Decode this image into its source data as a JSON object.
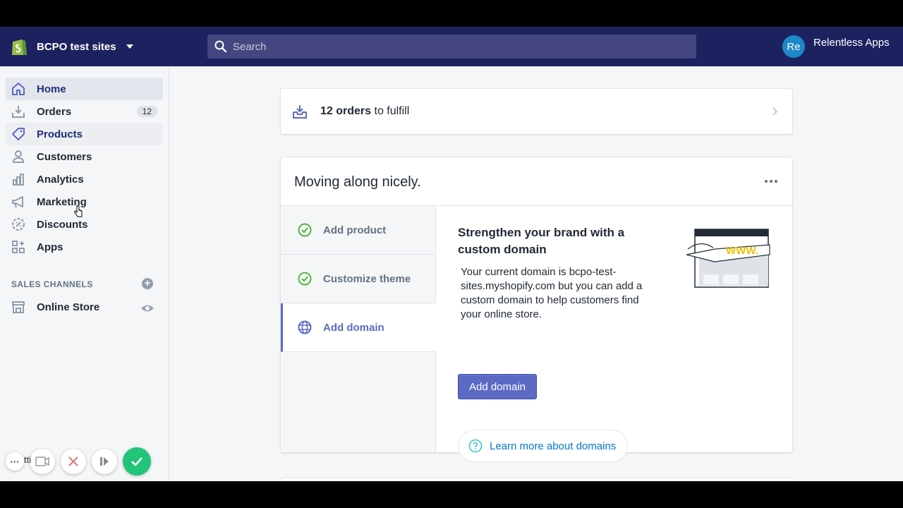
{
  "topbar": {
    "store_name": "BCPO test sites",
    "search_placeholder": "Search",
    "user_initials": "Re",
    "user_name": "Relentless Apps"
  },
  "sidebar": {
    "items": [
      {
        "label": "Home",
        "icon": "home-icon"
      },
      {
        "label": "Orders",
        "icon": "orders-icon",
        "badge": "12"
      },
      {
        "label": "Products",
        "icon": "tag-icon"
      },
      {
        "label": "Customers",
        "icon": "person-icon"
      },
      {
        "label": "Analytics",
        "icon": "bar-chart-icon"
      },
      {
        "label": "Marketing",
        "icon": "megaphone-icon"
      },
      {
        "label": "Discounts",
        "icon": "discount-icon"
      },
      {
        "label": "Apps",
        "icon": "apps-icon"
      }
    ],
    "channels_title": "SALES CHANNELS",
    "channels": [
      {
        "label": "Online Store",
        "icon": "store-icon"
      }
    ]
  },
  "orders_card": {
    "count": "12 orders",
    "suffix": " to fulfill"
  },
  "setup_card": {
    "title": "Moving along nicely.",
    "steps": [
      {
        "label": "Add product",
        "status": "complete"
      },
      {
        "label": "Customize theme",
        "status": "complete"
      },
      {
        "label": "Add domain",
        "status": "current"
      }
    ],
    "detail_title": "Strengthen your brand with a custom domain",
    "detail_body": "Your current domain is bcpo-test-sites.myshopify.com but you can add a custom domain to help customers find your online store.",
    "primary_button": "Add domain",
    "learn_more": "Learn more about domains",
    "illustration_text": "WWW."
  },
  "recorder": {
    "partial_label": "tti"
  },
  "colors": {
    "topbar": "#1c2260",
    "accent": "#5c6ac4",
    "success": "#50b83c",
    "link": "#007ace"
  }
}
